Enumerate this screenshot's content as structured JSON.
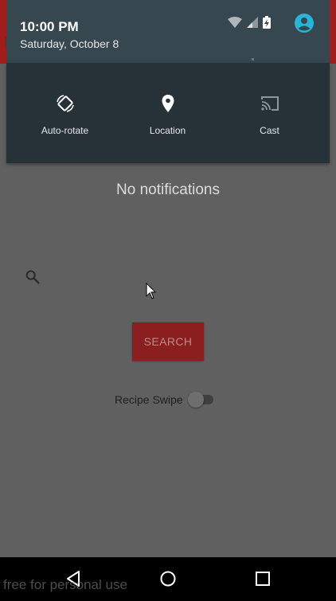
{
  "status_shade": {
    "time": "10:00 PM",
    "date": "Saturday, October 8"
  },
  "quick_settings": [
    {
      "label": "Auto-rotate",
      "icon": "auto-rotate-icon"
    },
    {
      "label": "Location",
      "icon": "location-pin-icon"
    },
    {
      "label": "Cast",
      "icon": "cast-icon"
    }
  ],
  "notifications": {
    "empty_text": "No notifications"
  },
  "app": {
    "search_button_label": "SEARCH",
    "toggle_label": "Recipe Swipe",
    "toggle_checked": false,
    "accent_color": "#a31c1c"
  },
  "nav": {
    "buttons": [
      "back-icon",
      "home-icon",
      "recents-icon"
    ]
  },
  "watermark": "free for personal use"
}
